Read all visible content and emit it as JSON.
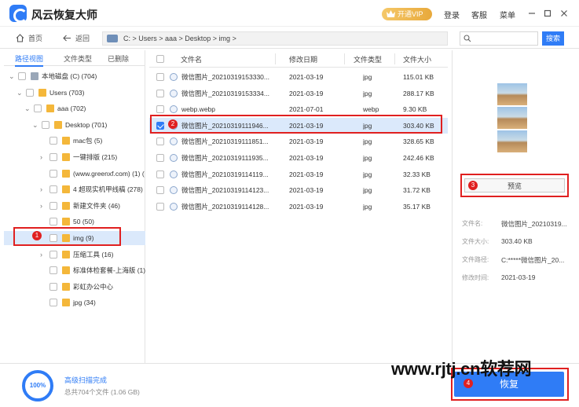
{
  "titlebar": {
    "app_title": "风云恢复大师",
    "vip_label": "开通VIP",
    "login": "登录",
    "support": "客服",
    "menu": "菜单"
  },
  "nav": {
    "home": "首页",
    "back": "返回",
    "path": "C: > Users > aaa > Desktop > img >",
    "search_placeholder": "",
    "search_button": "搜索"
  },
  "left": {
    "tabs": [
      "路径视图",
      "文件类型",
      "已删除"
    ],
    "tree": [
      {
        "label": "本地磁盘 (C) (704)",
        "indent": 0,
        "chev": "v",
        "folder": false
      },
      {
        "label": "Users (703)",
        "indent": 1,
        "chev": "v",
        "folder": true
      },
      {
        "label": "aaa (702)",
        "indent": 2,
        "chev": "v",
        "folder": true
      },
      {
        "label": "Desktop (701)",
        "indent": 3,
        "chev": "v",
        "folder": true
      },
      {
        "label": "mac包 (5)",
        "indent": 4,
        "chev": "",
        "folder": true
      },
      {
        "label": "一键排版 (215)",
        "indent": 4,
        "chev": ">",
        "folder": true
      },
      {
        "label": "(www.greenxf.com) (1) (",
        "indent": 4,
        "chev": "",
        "folder": true
      },
      {
        "label": "4 超现实机甲线稿 (278)",
        "indent": 4,
        "chev": ">",
        "folder": true
      },
      {
        "label": "新建文件夹 (46)",
        "indent": 4,
        "chev": ">",
        "folder": true
      },
      {
        "label": "50 (50)",
        "indent": 4,
        "chev": "",
        "folder": true
      },
      {
        "label": "img (9)",
        "indent": 4,
        "chev": "",
        "folder": true,
        "selected": true
      },
      {
        "label": "压缩工具 (16)",
        "indent": 4,
        "chev": ">",
        "folder": true
      },
      {
        "label": "标准体检套餐-上海版 (1)",
        "indent": 4,
        "chev": "",
        "folder": true
      },
      {
        "label": "彩虹办公中心",
        "indent": 4,
        "chev": "",
        "folder": true
      },
      {
        "label": "jpg (34)",
        "indent": 4,
        "chev": "",
        "folder": true
      }
    ]
  },
  "table": {
    "headers": [
      "文件名",
      "修改日期",
      "文件类型",
      "文件大小"
    ],
    "rows": [
      {
        "name": "微信图片_20210319153330...",
        "date": "2021-03-19",
        "type": "jpg",
        "size": "115.01  KB"
      },
      {
        "name": "微信图片_20210319153334...",
        "date": "2021-03-19",
        "type": "jpg",
        "size": "288.17  KB"
      },
      {
        "name": "webp.webp",
        "date": "2021-07-01",
        "type": "webp",
        "size": "9.30  KB"
      },
      {
        "name": "微信图片_20210319111946...",
        "date": "2021-03-19",
        "type": "jpg",
        "size": "303.40  KB",
        "selected": true
      },
      {
        "name": "微信图片_20210319111851...",
        "date": "2021-03-19",
        "type": "jpg",
        "size": "328.65  KB"
      },
      {
        "name": "微信图片_20210319111935...",
        "date": "2021-03-19",
        "type": "jpg",
        "size": "242.46  KB"
      },
      {
        "name": "微信图片_20210319114119...",
        "date": "2021-03-19",
        "type": "jpg",
        "size": "32.33  KB"
      },
      {
        "name": "微信图片_20210319114123...",
        "date": "2021-03-19",
        "type": "jpg",
        "size": "31.72  KB"
      },
      {
        "name": "微信图片_20210319114128...",
        "date": "2021-03-19",
        "type": "jpg",
        "size": "35.17  KB"
      }
    ]
  },
  "right": {
    "preview_button": "预览",
    "info": [
      {
        "label": "文件名:",
        "value": "微信图片_20210319..."
      },
      {
        "label": "文件大小:",
        "value": "303.40 KB"
      },
      {
        "label": "文件路径:",
        "value": "C:*****微信图片_20..."
      },
      {
        "label": "修改时间:",
        "value": "2021-03-19"
      }
    ]
  },
  "bottom": {
    "progress": "100%",
    "scan_title": "高级扫描完成",
    "scan_sub": "总共704个文件 (1.06 GB)",
    "recover_button": "恢复"
  },
  "annotations": {
    "badges": [
      "1",
      "2",
      "3",
      "4"
    ]
  },
  "watermark": "www.rjtj.cn软荐网",
  "colors": {
    "accent": "#2f7cf6",
    "selection": "#dbe9fb",
    "annotation": "#e02020",
    "folder": "#f4b73a"
  }
}
